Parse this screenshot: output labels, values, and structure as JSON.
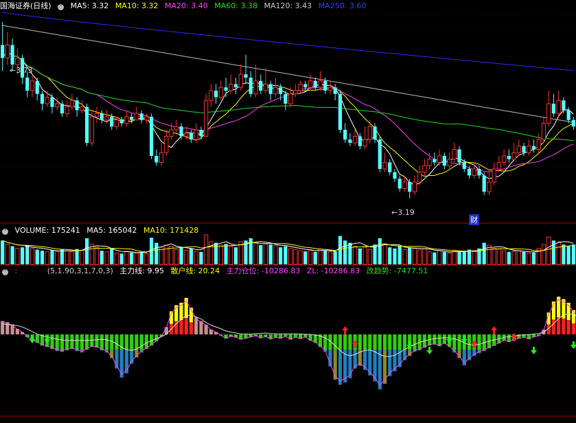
{
  "title": "国海证券(日线)",
  "colors": {
    "bg": "#000000",
    "up": "#ff3232",
    "down": "#54ffff",
    "grid": "#8b0000",
    "ma5": "#ffffff",
    "ma10": "#ffff00",
    "ma20": "#ff44ff",
    "ma60": "#22dd22",
    "ma120": "#bbbbbb",
    "ma250": "#2a2aff"
  },
  "price_panel": {
    "indicators": [
      {
        "label": "MA5: 3.32",
        "color": "#ffffff"
      },
      {
        "label": "MA10: 3.32",
        "color": "#ffff00"
      },
      {
        "label": "MA20: 3.40",
        "color": "#ff44ff"
      },
      {
        "label": "MA60: 3.38",
        "color": "#22dd22"
      },
      {
        "label": "MA120: 3.43",
        "color": "#cccccc"
      },
      {
        "label": "MA250: 3.60",
        "color": "#3c3cff"
      }
    ],
    "high_marker": "3.73",
    "low_marker": "3.19",
    "event_badge": "财"
  },
  "volume_panel": {
    "label": "VOLUME: 175241",
    "ma5": "MA5: 165042",
    "ma10": "MA10: 171428"
  },
  "indicator_panel": {
    "params": "(5,1.90,3,1,7,0,3)",
    "items": [
      {
        "label": "主力线: 9.95",
        "color": "#ffffff"
      },
      {
        "label": "散户线: 20.24",
        "color": "#ffff00"
      },
      {
        "label": "主力仓位: -10286.83",
        "color": "#ff44ff"
      },
      {
        "label": "ZL: -10286.83",
        "color": "#ff44ff"
      },
      {
        "label": "改趋势: -7477.51",
        "color": "#22dd22"
      }
    ]
  },
  "chart_data": {
    "type": "candlestick",
    "y_range": [
      3.12,
      3.76
    ],
    "candles": [
      [
        3.66,
        3.62,
        3.73,
        3.58
      ],
      [
        3.62,
        3.66,
        3.7,
        3.6
      ],
      [
        3.66,
        3.6,
        3.68,
        3.58
      ],
      [
        3.6,
        3.62,
        3.65,
        3.57
      ],
      [
        3.62,
        3.56,
        3.63,
        3.54
      ],
      [
        3.56,
        3.52,
        3.58,
        3.5
      ],
      [
        3.52,
        3.55,
        3.57,
        3.5
      ],
      [
        3.55,
        3.51,
        3.56,
        3.49
      ],
      [
        3.51,
        3.48,
        3.52,
        3.46
      ],
      [
        3.48,
        3.5,
        3.52,
        3.47
      ],
      [
        3.5,
        3.47,
        3.51,
        3.45
      ],
      [
        3.47,
        3.48,
        3.5,
        3.46
      ],
      [
        3.48,
        3.45,
        3.49,
        3.44
      ],
      [
        3.45,
        3.47,
        3.49,
        3.44
      ],
      [
        3.47,
        3.49,
        3.51,
        3.46
      ],
      [
        3.49,
        3.46,
        3.5,
        3.44
      ],
      [
        3.46,
        3.47,
        3.49,
        3.45
      ],
      [
        3.47,
        3.36,
        3.48,
        3.35
      ],
      [
        3.36,
        3.44,
        3.46,
        3.35
      ],
      [
        3.44,
        3.45,
        3.47,
        3.42
      ],
      [
        3.45,
        3.43,
        3.46,
        3.42
      ],
      [
        3.43,
        3.44,
        3.46,
        3.42
      ],
      [
        3.44,
        3.41,
        3.45,
        3.4
      ],
      [
        3.41,
        3.43,
        3.44,
        3.4
      ],
      [
        3.43,
        3.42,
        3.44,
        3.41
      ],
      [
        3.42,
        3.44,
        3.46,
        3.41
      ],
      [
        3.44,
        3.43,
        3.45,
        3.42
      ],
      [
        3.43,
        3.45,
        3.47,
        3.43
      ],
      [
        3.45,
        3.43,
        3.46,
        3.42
      ],
      [
        3.43,
        3.44,
        3.45,
        3.42
      ],
      [
        3.44,
        3.32,
        3.45,
        3.31
      ],
      [
        3.32,
        3.3,
        3.34,
        3.29
      ],
      [
        3.3,
        3.33,
        3.36,
        3.29
      ],
      [
        3.33,
        3.38,
        3.4,
        3.32
      ],
      [
        3.38,
        3.4,
        3.42,
        3.37
      ],
      [
        3.4,
        3.41,
        3.43,
        3.39
      ],
      [
        3.41,
        3.38,
        3.42,
        3.37
      ],
      [
        3.38,
        3.39,
        3.41,
        3.37
      ],
      [
        3.39,
        3.37,
        3.4,
        3.36
      ],
      [
        3.37,
        3.4,
        3.42,
        3.36
      ],
      [
        3.4,
        3.38,
        3.41,
        3.37
      ],
      [
        3.38,
        3.49,
        3.51,
        3.38
      ],
      [
        3.49,
        3.52,
        3.54,
        3.47
      ],
      [
        3.52,
        3.5,
        3.54,
        3.48
      ],
      [
        3.5,
        3.53,
        3.55,
        3.49
      ],
      [
        3.53,
        3.52,
        3.56,
        3.5
      ],
      [
        3.52,
        3.54,
        3.57,
        3.51
      ],
      [
        3.54,
        3.53,
        3.56,
        3.51
      ],
      [
        3.53,
        3.57,
        3.6,
        3.52
      ],
      [
        3.57,
        3.56,
        3.63,
        3.54
      ],
      [
        3.56,
        3.51,
        3.58,
        3.5
      ],
      [
        3.51,
        3.55,
        3.6,
        3.5
      ],
      [
        3.55,
        3.52,
        3.57,
        3.51
      ],
      [
        3.52,
        3.54,
        3.59,
        3.51
      ],
      [
        3.54,
        3.51,
        3.55,
        3.49
      ],
      [
        3.51,
        3.53,
        3.56,
        3.5
      ],
      [
        3.53,
        3.51,
        3.54,
        3.49
      ],
      [
        3.51,
        3.48,
        3.52,
        3.46
      ],
      [
        3.48,
        3.51,
        3.53,
        3.47
      ],
      [
        3.51,
        3.52,
        3.54,
        3.5
      ],
      [
        3.52,
        3.54,
        3.55,
        3.51
      ],
      [
        3.54,
        3.53,
        3.55,
        3.52
      ],
      [
        3.53,
        3.55,
        3.57,
        3.52
      ],
      [
        3.55,
        3.53,
        3.56,
        3.52
      ],
      [
        3.53,
        3.55,
        3.58,
        3.52
      ],
      [
        3.55,
        3.52,
        3.56,
        3.51
      ],
      [
        3.52,
        3.53,
        3.55,
        3.51
      ],
      [
        3.53,
        3.51,
        3.54,
        3.49
      ],
      [
        3.51,
        3.4,
        3.52,
        3.39
      ],
      [
        3.4,
        3.37,
        3.42,
        3.36
      ],
      [
        3.37,
        3.36,
        3.39,
        3.35
      ],
      [
        3.36,
        3.38,
        3.4,
        3.35
      ],
      [
        3.38,
        3.35,
        3.39,
        3.34
      ],
      [
        3.35,
        3.37,
        3.41,
        3.34
      ],
      [
        3.37,
        3.41,
        3.43,
        3.36
      ],
      [
        3.41,
        3.37,
        3.42,
        3.36
      ],
      [
        3.37,
        3.28,
        3.38,
        3.27
      ],
      [
        3.28,
        3.3,
        3.33,
        3.27
      ],
      [
        3.3,
        3.27,
        3.31,
        3.26
      ],
      [
        3.27,
        3.25,
        3.28,
        3.24
      ],
      [
        3.25,
        3.22,
        3.26,
        3.21
      ],
      [
        3.22,
        3.24,
        3.26,
        3.21
      ],
      [
        3.24,
        3.21,
        3.25,
        3.19
      ],
      [
        3.21,
        3.24,
        3.26,
        3.2
      ],
      [
        3.24,
        3.27,
        3.29,
        3.23
      ],
      [
        3.27,
        3.29,
        3.31,
        3.26
      ],
      [
        3.29,
        3.31,
        3.33,
        3.28
      ],
      [
        3.31,
        3.3,
        3.33,
        3.29
      ],
      [
        3.3,
        3.32,
        3.34,
        3.29
      ],
      [
        3.32,
        3.29,
        3.33,
        3.28
      ],
      [
        3.29,
        3.31,
        3.33,
        3.28
      ],
      [
        3.31,
        3.34,
        3.36,
        3.3
      ],
      [
        3.34,
        3.3,
        3.35,
        3.29
      ],
      [
        3.3,
        3.28,
        3.31,
        3.27
      ],
      [
        3.28,
        3.26,
        3.29,
        3.25
      ],
      [
        3.26,
        3.28,
        3.3,
        3.25
      ],
      [
        3.28,
        3.26,
        3.29,
        3.25
      ],
      [
        3.26,
        3.21,
        3.27,
        3.2
      ],
      [
        3.21,
        3.24,
        3.28,
        3.2
      ],
      [
        3.24,
        3.28,
        3.3,
        3.23
      ],
      [
        3.28,
        3.3,
        3.32,
        3.27
      ],
      [
        3.3,
        3.32,
        3.34,
        3.29
      ],
      [
        3.32,
        3.31,
        3.34,
        3.3
      ],
      [
        3.31,
        3.33,
        3.36,
        3.3
      ],
      [
        3.33,
        3.35,
        3.37,
        3.32
      ],
      [
        3.35,
        3.33,
        3.36,
        3.32
      ],
      [
        3.33,
        3.35,
        3.37,
        3.32
      ],
      [
        3.35,
        3.34,
        3.37,
        3.33
      ],
      [
        3.34,
        3.37,
        3.39,
        3.33
      ],
      [
        3.37,
        3.42,
        3.44,
        3.36
      ],
      [
        3.42,
        3.48,
        3.52,
        3.41
      ],
      [
        3.48,
        3.45,
        3.51,
        3.44
      ],
      [
        3.45,
        3.49,
        3.52,
        3.44
      ],
      [
        3.49,
        3.46,
        3.5,
        3.45
      ],
      [
        3.46,
        3.43,
        3.47,
        3.42
      ],
      [
        3.43,
        3.41,
        3.44,
        3.4
      ]
    ],
    "volume_range": [
      0,
      460000
    ],
    "volumes": [
      210000,
      180000,
      160000,
      140000,
      150000,
      170000,
      140000,
      130000,
      120000,
      110000,
      125000,
      115000,
      130000,
      120000,
      110000,
      135000,
      125000,
      230000,
      180000,
      150000,
      120000,
      110000,
      140000,
      100000,
      95000,
      115000,
      105000,
      100000,
      110000,
      95000,
      235000,
      190000,
      150000,
      170000,
      160000,
      130000,
      150000,
      125000,
      140000,
      115000,
      110000,
      260000,
      200000,
      190000,
      170000,
      180000,
      160000,
      150000,
      200000,
      210000,
      230000,
      190000,
      170000,
      180000,
      175000,
      165000,
      150000,
      160000,
      140000,
      130000,
      120000,
      115000,
      130000,
      110000,
      135000,
      120000,
      110000,
      115000,
      250000,
      210000,
      190000,
      160000,
      140000,
      150000,
      130000,
      175000,
      230000,
      180000,
      150000,
      140000,
      160000,
      130000,
      150000,
      140000,
      130000,
      140000,
      110000,
      105000,
      120000,
      110000,
      100000,
      125000,
      115000,
      110000,
      130000,
      120000,
      140000,
      190000,
      170000,
      140000,
      135000,
      120000,
      110000,
      115000,
      120000,
      110000,
      100000,
      105000,
      140000,
      175000,
      240000,
      210000,
      200000,
      175000,
      165000,
      175000
    ],
    "indicator_range": [
      -16000,
      10000
    ],
    "indicator": [
      2200,
      2000,
      1600,
      900,
      400,
      -800,
      -1600,
      -2400,
      -3200,
      -3600,
      -4200,
      -4800,
      -5000,
      -4600,
      -4200,
      -4800,
      -5200,
      -4400,
      -3600,
      -3800,
      -4600,
      -5200,
      -6800,
      -9800,
      -12400,
      -11200,
      -8400,
      -6600,
      -5200,
      -4200,
      -3200,
      -2000,
      -600,
      1200,
      3800,
      4800,
      5200,
      6000,
      4400,
      2800,
      2200,
      1600,
      800,
      400,
      -300,
      -1200,
      -600,
      -900,
      -1500,
      -1200,
      -800,
      -400,
      -1100,
      -700,
      -1400,
      -900,
      -1200,
      -600,
      -1500,
      -900,
      -1300,
      -800,
      -1800,
      -2400,
      -3600,
      -5000,
      -9200,
      -13000,
      -14500,
      -13800,
      -12600,
      -9800,
      -9000,
      -10200,
      -11800,
      -13500,
      -15800,
      -14200,
      -12000,
      -10600,
      -9400,
      -7400,
      -6200,
      -5000,
      -4600,
      -3800,
      -3200,
      -2900,
      -3400,
      -2700,
      -3600,
      -5200,
      -6800,
      -8900,
      -7400,
      -6200,
      -5400,
      -4800,
      -4000,
      -3300,
      -2600,
      -1800,
      -2200,
      -1700,
      -1200,
      -900,
      -1400,
      -800,
      -400,
      800,
      3600,
      5400,
      6200,
      5800,
      5200,
      4000,
      3000,
      2000
    ],
    "signals": [
      {
        "i": 6,
        "dir": "down"
      },
      {
        "i": 9,
        "dir": "down"
      },
      {
        "i": 69,
        "dir": "up"
      },
      {
        "i": 71,
        "dir": "up"
      },
      {
        "i": 82,
        "dir": "down"
      },
      {
        "i": 86,
        "dir": "down"
      },
      {
        "i": 90,
        "dir": "down"
      },
      {
        "i": 93,
        "dir": "down"
      },
      {
        "i": 95,
        "dir": "up"
      },
      {
        "i": 99,
        "dir": "up"
      },
      {
        "i": 103,
        "dir": "up"
      },
      {
        "i": 107,
        "dir": "down"
      },
      {
        "i": 115,
        "dir": "down"
      },
      {
        "i": 119,
        "dir": "down"
      },
      {
        "i": 127,
        "dir": "up"
      },
      {
        "i": 133,
        "dir": "up"
      },
      {
        "i": 141,
        "dir": "up"
      },
      {
        "i": 148,
        "dir": "down"
      },
      {
        "i": 157,
        "dir": "down"
      },
      {
        "i": 170,
        "dir": "up"
      },
      {
        "i": 178,
        "dir": "down"
      },
      {
        "i": 186,
        "dir": "down"
      },
      {
        "i": 189,
        "dir": "down"
      },
      {
        "i": 194,
        "dir": "up"
      }
    ]
  }
}
